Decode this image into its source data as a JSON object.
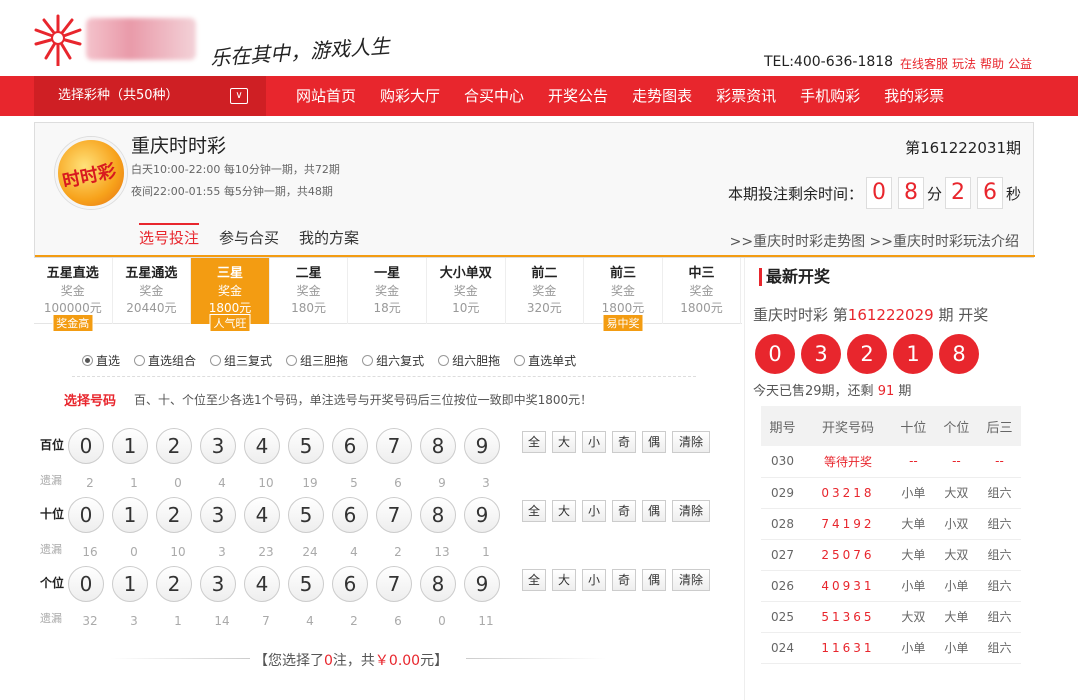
{
  "header": {
    "slogan": "乐在其中，游戏人生",
    "hotline": "TEL:400-636-1818",
    "links": [
      "在线客服",
      "玩法",
      "帮助",
      "公益"
    ]
  },
  "nav": {
    "select_label": "选择彩种（共50种）",
    "select_arrow": "∨",
    "items": [
      "网站首页",
      "购彩大厅",
      "合买中心",
      "开奖公告",
      "走势图表",
      "彩票资讯",
      "手机购彩",
      "我的彩票"
    ]
  },
  "lottery": {
    "logo_text": "时时彩",
    "title": "重庆时时彩",
    "day_schedule": "白天10:00-22:00 每10分钟一期，共72期",
    "night_schedule": "夜间22:00-01:55 每5分钟一期，共48期",
    "period": "第161222031期",
    "timer_label": "本期投注剩余时间：",
    "minutes": [
      "0",
      "8"
    ],
    "min_unit": "分",
    "seconds": [
      "2",
      "6"
    ],
    "sec_unit": "秒",
    "tabs": [
      "选号投注",
      "参与合买",
      "我的方案"
    ],
    "links": ">>重庆时时彩走势图 >>重庆时时彩玩法介绍"
  },
  "plays": [
    {
      "name": "五星直选",
      "label": "奖金",
      "value": "100000元",
      "tag": "奖金高"
    },
    {
      "name": "五星通选",
      "label": "奖金",
      "value": "20440元",
      "tag": ""
    },
    {
      "name": "三星",
      "label": "奖金",
      "value": "1800元",
      "tag": "人气旺"
    },
    {
      "name": "二星",
      "label": "奖金",
      "value": "180元",
      "tag": ""
    },
    {
      "name": "一星",
      "label": "奖金",
      "value": "18元",
      "tag": ""
    },
    {
      "name": "大小单双",
      "label": "奖金",
      "value": "10元",
      "tag": ""
    },
    {
      "name": "前二",
      "label": "奖金",
      "value": "320元",
      "tag": ""
    },
    {
      "name": "前三",
      "label": "奖金",
      "value": "1800元",
      "tag": "易中奖"
    },
    {
      "name": "中三",
      "label": "奖金",
      "value": "1800元",
      "tag": ""
    }
  ],
  "modes": [
    "直选",
    "直选组合",
    "组三复式",
    "组三胆拖",
    "组六复式",
    "组六胆拖",
    "直选单式"
  ],
  "pick": {
    "title": "选择号码",
    "desc": "百、十、个位至少各选1个号码，单注选号与开奖号码后三位按位一致即中奖1800元！",
    "miss_label": "遗漏",
    "quick": [
      "全",
      "大",
      "小",
      "奇",
      "偶",
      "清除"
    ]
  },
  "rows": [
    {
      "pos": "百位",
      "balls": [
        "0",
        "1",
        "2",
        "3",
        "4",
        "5",
        "6",
        "7",
        "8",
        "9"
      ],
      "miss": [
        "2",
        "1",
        "0",
        "4",
        "10",
        "19",
        "5",
        "6",
        "9",
        "3"
      ]
    },
    {
      "pos": "十位",
      "balls": [
        "0",
        "1",
        "2",
        "3",
        "4",
        "5",
        "6",
        "7",
        "8",
        "9"
      ],
      "miss": [
        "16",
        "0",
        "10",
        "3",
        "23",
        "24",
        "4",
        "2",
        "13",
        "1"
      ]
    },
    {
      "pos": "个位",
      "balls": [
        "0",
        "1",
        "2",
        "3",
        "4",
        "5",
        "6",
        "7",
        "8",
        "9"
      ],
      "miss": [
        "32",
        "3",
        "1",
        "14",
        "7",
        "4",
        "2",
        "6",
        "0",
        "11"
      ]
    }
  ],
  "summary": {
    "pre": "【您选择了",
    "count": "0",
    "mid": "注，共",
    "amount": "￥0.00",
    "post": "元】"
  },
  "latest": {
    "title": "最新开奖",
    "name": "重庆时时彩 第",
    "period": "161222029",
    "post": " 期 开奖",
    "balls": [
      "0",
      "3",
      "2",
      "1",
      "8"
    ],
    "sold_pre": "今天已售29期，还剩 ",
    "remain": "91",
    "sold_post": " 期",
    "headers": [
      "期号",
      "开奖号码",
      "十位",
      "个位",
      "后三"
    ],
    "rows": [
      [
        "030",
        "等待开奖",
        "--",
        "--",
        "--"
      ],
      [
        "029",
        "03218",
        "小单",
        "大双",
        "组六"
      ],
      [
        "028",
        "74192",
        "大单",
        "小双",
        "组六"
      ],
      [
        "027",
        "25076",
        "大单",
        "大双",
        "组六"
      ],
      [
        "026",
        "40931",
        "小单",
        "小单",
        "组六"
      ],
      [
        "025",
        "51365",
        "大双",
        "大单",
        "组六"
      ],
      [
        "024",
        "11631",
        "小单",
        "小单",
        "组六"
      ]
    ]
  }
}
